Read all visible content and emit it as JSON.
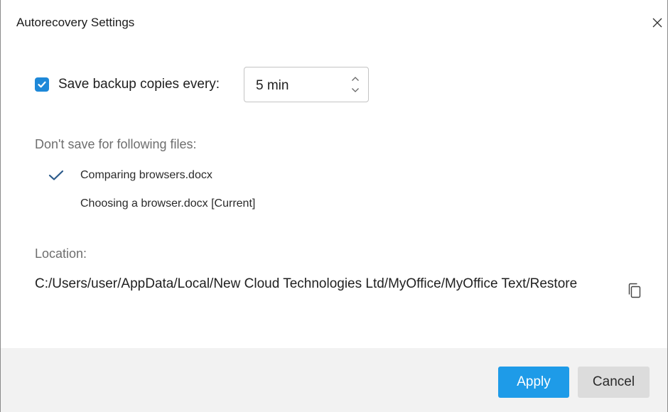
{
  "dialog": {
    "title": "Autorecovery Settings",
    "close_icon": "close-icon"
  },
  "backup": {
    "checked": true,
    "label": "Save backup copies every:",
    "interval_value": "5 min"
  },
  "exclusions": {
    "label": "Don't save for following files:",
    "files": [
      {
        "name": "Comparing browsers.docx",
        "checked": true
      },
      {
        "name": "Choosing a browser.docx [Current]",
        "checked": false
      }
    ]
  },
  "location": {
    "label": "Location:",
    "path": "C:/Users/user/AppData/Local/New Cloud Technologies Ltd/MyOffice/MyOffice Text/Restore",
    "copy_icon": "copy-icon"
  },
  "footer": {
    "apply_label": "Apply",
    "cancel_label": "Cancel"
  },
  "colors": {
    "accent": "#1e9be8",
    "checkbox": "#1e88d8",
    "check_mark": "#2b5a8a"
  }
}
